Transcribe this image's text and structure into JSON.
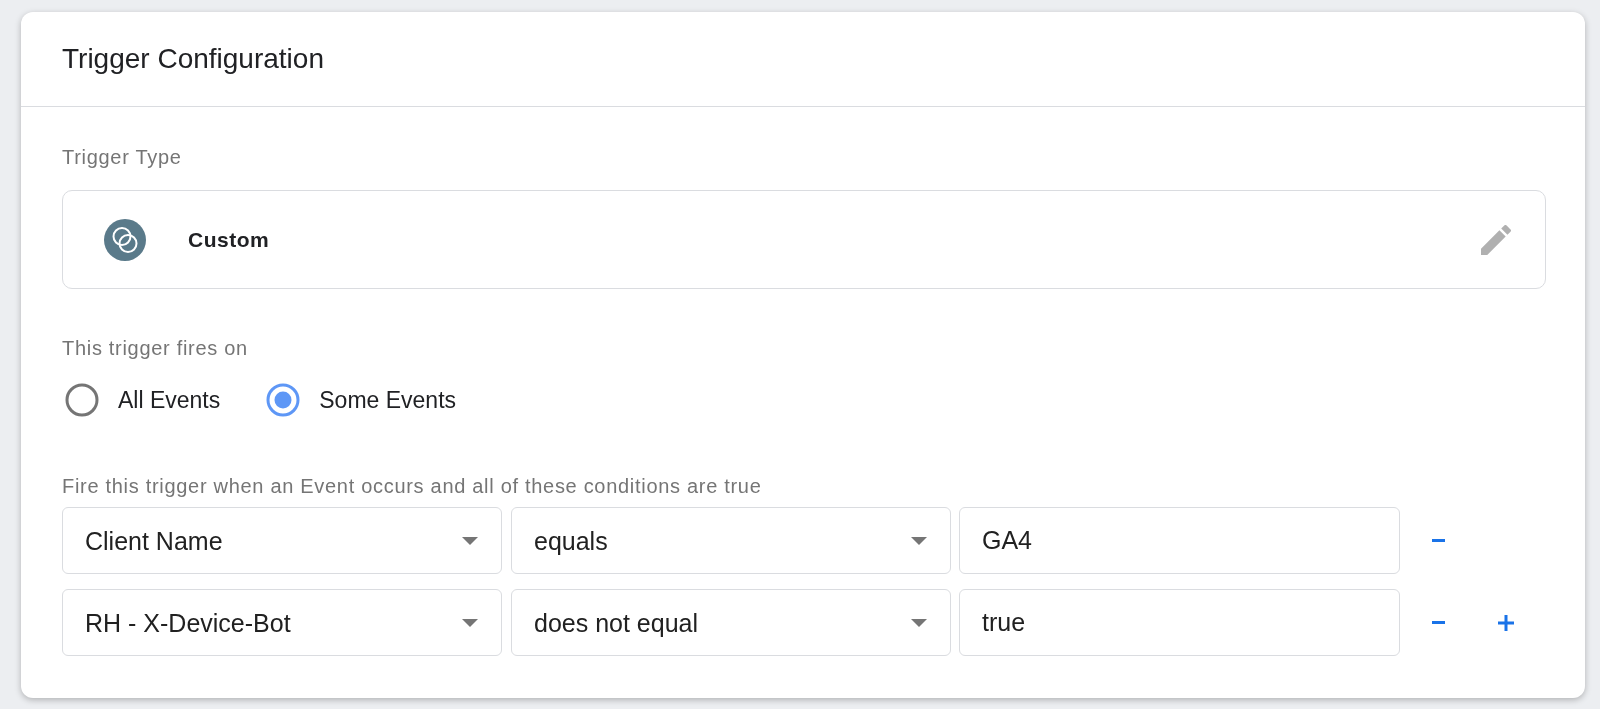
{
  "header": {
    "title": "Trigger Configuration"
  },
  "trigger_type": {
    "label": "Trigger Type",
    "name": "Custom"
  },
  "fires_on": {
    "label": "This trigger fires on",
    "options": [
      {
        "label": "All Events",
        "selected": false
      },
      {
        "label": "Some Events",
        "selected": true
      }
    ]
  },
  "conditions": {
    "label": "Fire this trigger when an Event occurs and all of these conditions are true",
    "rows": [
      {
        "variable": "Client Name",
        "operator": "equals",
        "value": "GA4",
        "add_button": false
      },
      {
        "variable": "RH - X-Device-Bot",
        "operator": "does not equal",
        "value": "true",
        "add_button": true
      }
    ]
  }
}
